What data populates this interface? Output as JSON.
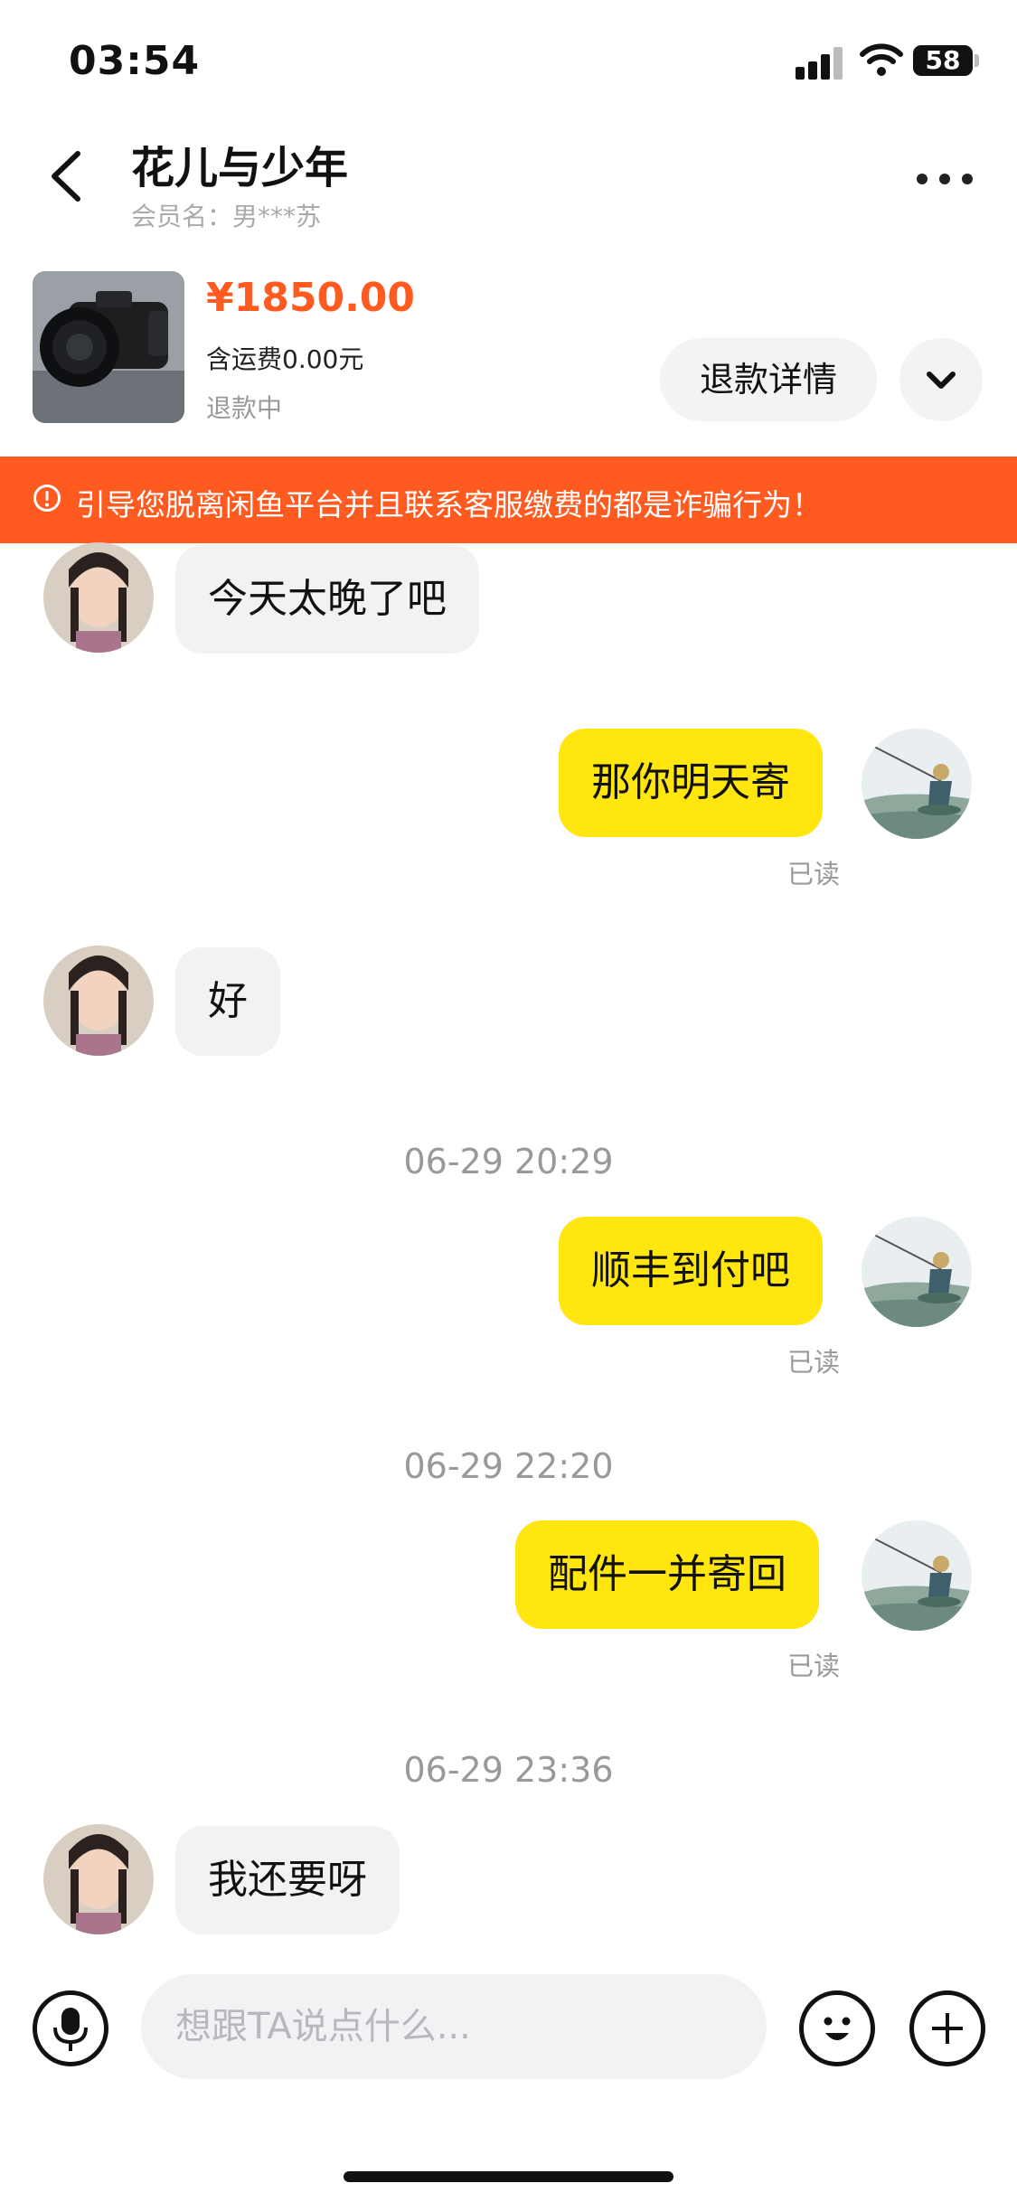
{
  "status_bar": {
    "time": "03:54",
    "battery": "58"
  },
  "header": {
    "title": "花儿与少年",
    "member_name": "会员名：男***苏"
  },
  "product": {
    "price": "¥1850.00",
    "shipping": "含运费0.00元",
    "status": "退款中",
    "refund_button": "退款详情"
  },
  "warning": {
    "text": "引导您脱离闲鱼平台并且联系客服缴费的都是诈骗行为！"
  },
  "messages": [
    {
      "type": "in",
      "text": "今天太晚了吧"
    },
    {
      "type": "out",
      "text": "那你明天寄",
      "status": "已读"
    },
    {
      "type": "in",
      "text": "好"
    },
    {
      "type": "time",
      "text": "06-29 20:29"
    },
    {
      "type": "out",
      "text": "顺丰到付吧",
      "status": "已读"
    },
    {
      "type": "time",
      "text": "06-29 22:20"
    },
    {
      "type": "out",
      "text": "配件一并寄回",
      "status": "已读"
    },
    {
      "type": "time",
      "text": "06-29 23:36"
    },
    {
      "type": "in",
      "text": "我还要呀"
    }
  ],
  "input": {
    "placeholder": "想跟TA说点什么..."
  },
  "icons": {
    "back": "chevron-left-icon",
    "more": "more-dots-icon",
    "expand": "chevron-down-icon",
    "warning": "exclamation-circle-icon",
    "mic": "microphone-icon",
    "emoji": "smiley-icon",
    "plus": "plus-icon"
  },
  "colors": {
    "accent": "#ff5a1f",
    "outgoing_bubble": "#ffe60f",
    "incoming_bubble": "#f2f2f5"
  }
}
